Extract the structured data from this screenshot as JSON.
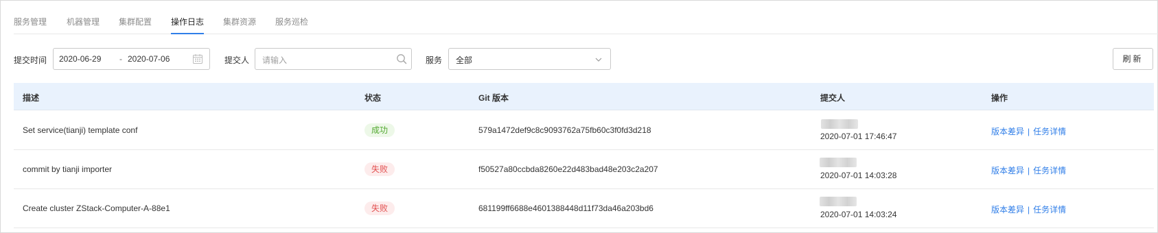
{
  "tabs": [
    {
      "label": "服务管理",
      "active": false
    },
    {
      "label": "机器管理",
      "active": false
    },
    {
      "label": "集群配置",
      "active": false
    },
    {
      "label": "操作日志",
      "active": true
    },
    {
      "label": "集群资源",
      "active": false
    },
    {
      "label": "服务巡检",
      "active": false
    }
  ],
  "filters": {
    "time_label": "提交时间",
    "date_start": "2020-06-29",
    "date_sep": "-",
    "date_end": "2020-07-06",
    "submitter_label": "提交人",
    "submitter_placeholder": "请输入",
    "service_label": "服务",
    "service_value": "全部",
    "refresh_label": "刷新"
  },
  "table": {
    "columns": [
      "描述",
      "状态",
      "Git 版本",
      "提交人",
      "操作"
    ],
    "rows": [
      {
        "desc": "Set service(tianji) template conf",
        "status": "成功",
        "status_type": "ok",
        "git": "579a1472def9c8c9093762a75fb60c3f0fd3d218",
        "time": "2020-07-01 17:46:47",
        "action1": "版本差异",
        "sep": "|",
        "action2": "任务详情"
      },
      {
        "desc": "commit by tianji importer",
        "status": "失败",
        "status_type": "fail",
        "git": "f50527a80ccbda8260e22d483bad48e203c2a207",
        "time": "2020-07-01 14:03:28",
        "action1": "版本差异",
        "sep": "|",
        "action2": "任务详情"
      },
      {
        "desc": "Create cluster ZStack-Computer-A-88e1",
        "status": "失败",
        "status_type": "fail",
        "git": "681199ff6688e4601388448d11f73da46a203bd6",
        "time": "2020-07-01 14:03:24",
        "action1": "版本差异",
        "sep": "|",
        "action2": "任务详情"
      }
    ]
  },
  "colors": {
    "accent": "#2f7ee8",
    "header_bg": "#e9f2fd",
    "success": "#52a830",
    "danger": "#e25050"
  },
  "icons": {
    "date": "calendar-icon",
    "search": "search-icon",
    "select": "chevron-down-icon"
  }
}
